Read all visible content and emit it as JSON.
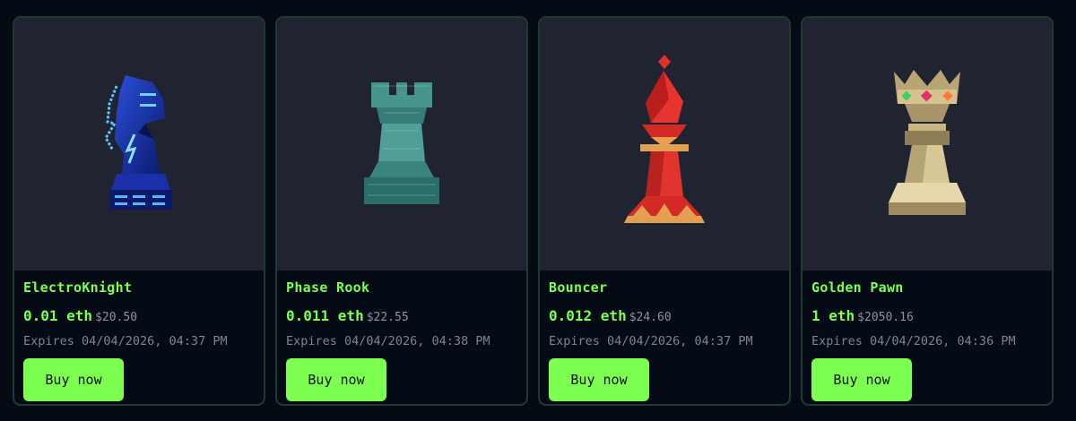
{
  "currency_label": "eth",
  "listings": [
    {
      "name": "ElectroKnight",
      "price_eth": "0.01 eth",
      "price_usd": "$20.50",
      "expires": "Expires 04/04/2026, 04:37 PM",
      "buy_label": "Buy now",
      "icon": "electro-knight-icon"
    },
    {
      "name": "Phase Rook",
      "price_eth": "0.011 eth",
      "price_usd": "$22.55",
      "expires": "Expires 04/04/2026, 04:38 PM",
      "buy_label": "Buy now",
      "icon": "phase-rook-icon"
    },
    {
      "name": "Bouncer",
      "price_eth": "0.012 eth",
      "price_usd": "$24.60",
      "expires": "Expires 04/04/2026, 04:37 PM",
      "buy_label": "Buy now",
      "icon": "bouncer-bishop-icon"
    },
    {
      "name": "Golden Pawn",
      "price_eth": "1 eth",
      "price_usd": "$2050.16",
      "expires": "Expires 04/04/2026, 04:36 PM",
      "buy_label": "Buy now",
      "icon": "golden-pawn-icon"
    }
  ],
  "colors": {
    "accent": "#7cff4f",
    "page_bg": "#050b14",
    "card_art_bg": "#1f2430",
    "card_border": "#1f3a2e"
  }
}
